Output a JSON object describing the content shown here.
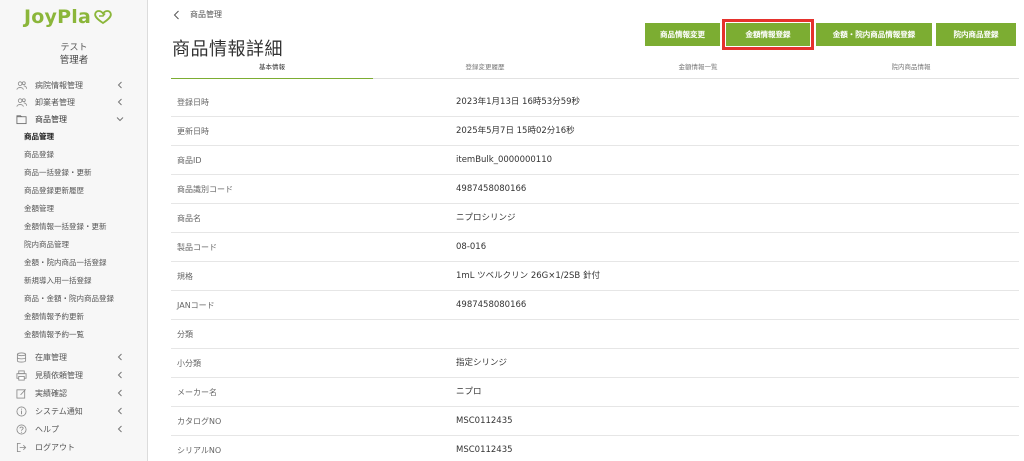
{
  "brand": {
    "name": "JoyPla",
    "accent": "#8bb63a"
  },
  "user": {
    "name": "テスト",
    "role": "管理者"
  },
  "sidebar": {
    "groups_top": [
      {
        "label": "病院情報管理",
        "icon": "users-icon",
        "chevron": "left"
      },
      {
        "label": "卸業者管理",
        "icon": "users-icon",
        "chevron": "left"
      },
      {
        "label": "商品管理",
        "icon": "folder-icon",
        "chevron": "down"
      }
    ],
    "sub_items": [
      {
        "label": "商品管理",
        "active": true
      },
      {
        "label": "商品登録"
      },
      {
        "label": "商品一括登録・更新"
      },
      {
        "label": "商品登録更新履歴"
      },
      {
        "label": "金額管理"
      },
      {
        "label": "金額情報一括登録・更新"
      },
      {
        "label": "院内商品管理"
      },
      {
        "label": "金額・院内商品一括登録"
      },
      {
        "label": "新規導入用一括登録"
      },
      {
        "label": "商品・金額・院内商品登録"
      },
      {
        "label": "金額情報予約更新"
      },
      {
        "label": "金額情報予約一覧"
      }
    ],
    "groups_bottom": [
      {
        "label": "在庫管理",
        "icon": "database-icon",
        "chevron": "left"
      },
      {
        "label": "見積依頼管理",
        "icon": "printer-icon",
        "chevron": "left"
      },
      {
        "label": "実績確認",
        "icon": "edit-icon",
        "chevron": "left"
      },
      {
        "label": "システム通知",
        "icon": "info-icon",
        "chevron": "left"
      },
      {
        "label": "ヘルプ",
        "icon": "question-icon",
        "chevron": "left"
      },
      {
        "label": "ログアウト",
        "icon": "sign-out-icon",
        "chevron": ""
      }
    ]
  },
  "breadcrumb": {
    "label": "商品管理"
  },
  "page": {
    "title": "商品情報詳細"
  },
  "actions": [
    {
      "label": "商品情報変更"
    },
    {
      "label": "金額情報登録",
      "highlighted": true
    },
    {
      "label": "金額・院内商品情報登録"
    },
    {
      "label": "院内商品登録"
    }
  ],
  "tabs": [
    {
      "label": "基本情報",
      "active": true
    },
    {
      "label": "登録変更履歴"
    },
    {
      "label": "金額情報一覧"
    },
    {
      "label": "院内商品情報"
    }
  ],
  "details": [
    {
      "label": "登録日時",
      "value": "2023年1月13日 16時53分59秒"
    },
    {
      "label": "更新日時",
      "value": "2025年5月7日 15時02分16秒"
    },
    {
      "label": "商品ID",
      "value": "itemBulk_0000000110"
    },
    {
      "label": "商品識別コード",
      "value": "4987458080166"
    },
    {
      "label": "商品名",
      "value": "ニプロシリンジ"
    },
    {
      "label": "製品コード",
      "value": "08-016"
    },
    {
      "label": "規格",
      "value": "1mL ツベルクリン 26G×1/2SB 針付"
    },
    {
      "label": "JANコード",
      "value": "4987458080166"
    },
    {
      "label": "分類",
      "value": ""
    },
    {
      "label": "小分類",
      "value": "指定シリンジ"
    },
    {
      "label": "メーカー名",
      "value": "ニプロ"
    },
    {
      "label": "カタログNO",
      "value": "MSC0112435"
    },
    {
      "label": "シリアルNO",
      "value": "MSC0112435"
    }
  ]
}
